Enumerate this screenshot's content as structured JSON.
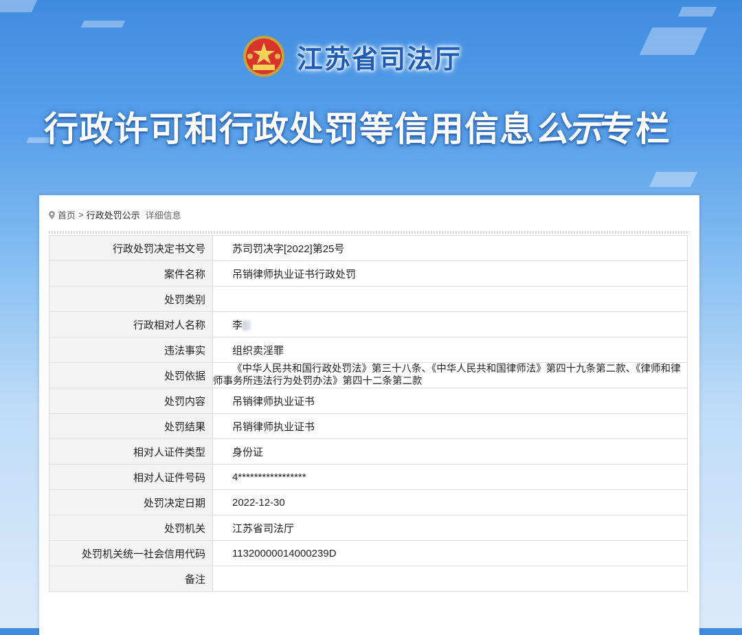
{
  "banner": {
    "department": "江苏省司法厅",
    "headline_main": "行政许可和行政处罚等信用信息",
    "headline_brush": "公示",
    "headline_tail": "专栏"
  },
  "breadcrumb": {
    "home": "首页",
    "separator": ">",
    "section": "行政处罚公示",
    "current": "详细信息"
  },
  "rows": [
    {
      "label": "行政处罚决定书文号",
      "value": "苏司罚决字[2022]第25号"
    },
    {
      "label": "案件名称",
      "value": "吊销律师执业证书行政处罚"
    },
    {
      "label": "处罚类别",
      "value": ""
    },
    {
      "label": "行政相对人名称",
      "value": "李"
    },
    {
      "label": "违法事实",
      "value": "组织卖淫罪"
    },
    {
      "label": "处罚依据",
      "value": "《中华人民共和国行政处罚法》第三十八条、《中华人民共和国律师法》第四十九条第二款、《律师和律师事务所违法行为处罚办法》第四十二条第二款"
    },
    {
      "label": "处罚内容",
      "value": "吊销律师执业证书"
    },
    {
      "label": "处罚结果",
      "value": "吊销律师执业证书"
    },
    {
      "label": "相对人证件类型",
      "value": "身份证"
    },
    {
      "label": "相对人证件号码",
      "value": "4*****************"
    },
    {
      "label": "处罚决定日期",
      "value": "2022-12-30"
    },
    {
      "label": "处罚机关",
      "value": "江苏省司法厅"
    },
    {
      "label": "处罚机关统一社会信用代码",
      "value": "11320000014000239D"
    },
    {
      "label": "备注",
      "value": ""
    }
  ]
}
